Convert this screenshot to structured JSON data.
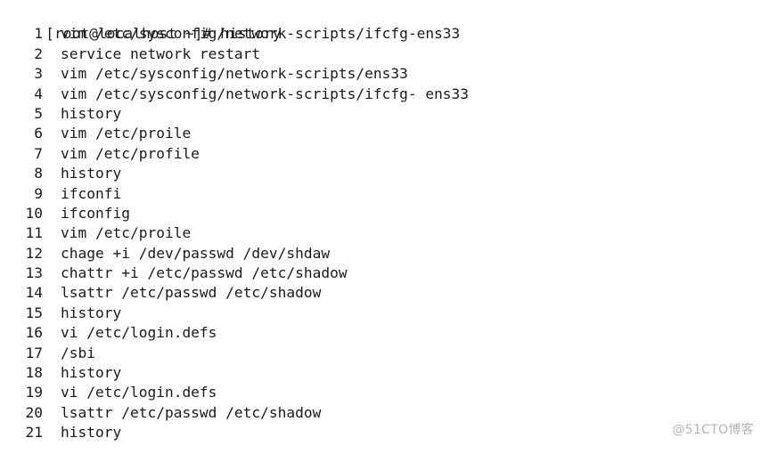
{
  "terminal": {
    "background_color": "#ffffff",
    "text_color": "#1a1a1a",
    "prompt": {
      "prefix": "[root@localhost ~]# ",
      "command": "history"
    },
    "history": [
      {
        "num": "1",
        "command": "vim /etc/sysconfig/network-scripts/ifcfg-ens33"
      },
      {
        "num": "2",
        "command": "service network restart"
      },
      {
        "num": "3",
        "command": "vim /etc/sysconfig/network-scripts/ens33"
      },
      {
        "num": "4",
        "command": "vim /etc/sysconfig/network-scripts/ifcfg- ens33"
      },
      {
        "num": "5",
        "command": "history"
      },
      {
        "num": "6",
        "command": "vim /etc/proile"
      },
      {
        "num": "7",
        "command": "vim /etc/profile"
      },
      {
        "num": "8",
        "command": "history"
      },
      {
        "num": "9",
        "command": "ifconfi"
      },
      {
        "num": "10",
        "command": "ifconfig"
      },
      {
        "num": "11",
        "command": "vim /etc/proile"
      },
      {
        "num": "12",
        "command": "chage +i /dev/passwd /dev/shdaw"
      },
      {
        "num": "13",
        "command": "chattr +i /etc/passwd /etc/shadow"
      },
      {
        "num": "14",
        "command": "lsattr /etc/passwd /etc/shadow"
      },
      {
        "num": "15",
        "command": "history"
      },
      {
        "num": "16",
        "command": "vi /etc/login.defs"
      },
      {
        "num": "17",
        "command": "/sbi"
      },
      {
        "num": "18",
        "command": "history"
      },
      {
        "num": "19",
        "command": "vi /etc/login.defs"
      },
      {
        "num": "20",
        "command": "lsattr /etc/passwd /etc/shadow"
      },
      {
        "num": "21",
        "command": "history"
      }
    ]
  },
  "watermark": {
    "text": "@51CTO博客",
    "color": "#b4b4b4"
  }
}
